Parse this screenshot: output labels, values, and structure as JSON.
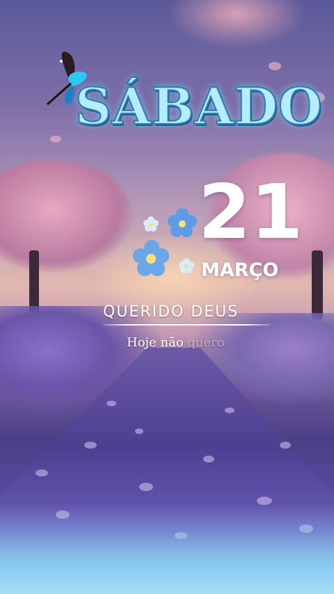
{
  "header": {
    "weekday": "SÁBADO"
  },
  "date": {
    "day": "21",
    "month": "MARÇO"
  },
  "prayer": {
    "title": "QUERIDO DEUS",
    "line_visible": "Hoje não ",
    "line_fading": "quero"
  },
  "colors": {
    "title_fill": "#b6ecff",
    "title_outline": "#2d7fb0",
    "flower_blue": "#6aa6e8",
    "flower_center": "#f6e27a",
    "text": "#ffffff"
  },
  "icons": {
    "butterfly": "butterfly-icon",
    "flowers": "forget-me-not-flowers-icon"
  }
}
